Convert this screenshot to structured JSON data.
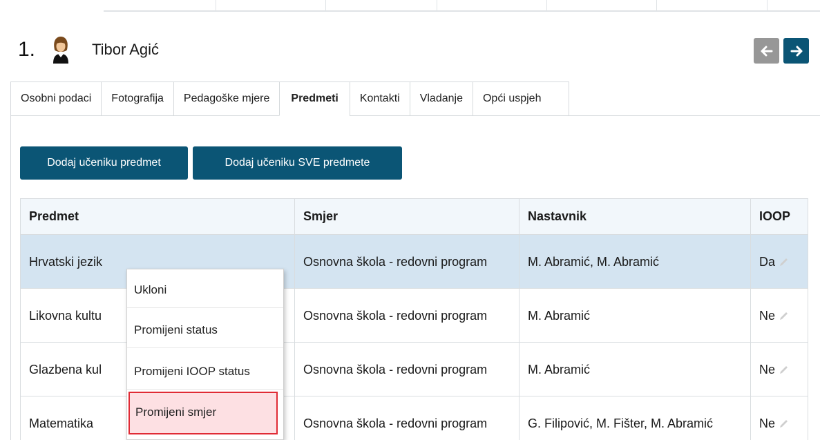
{
  "header": {
    "number": "1.",
    "student_name": "Tibor Agić"
  },
  "tabs": [
    {
      "label": "Osobni podaci",
      "active": false
    },
    {
      "label": "Fotografija",
      "active": false
    },
    {
      "label": "Pedagoške mjere",
      "active": false
    },
    {
      "label": "Predmeti",
      "active": true
    },
    {
      "label": "Kontakti",
      "active": false
    },
    {
      "label": "Vladanje",
      "active": false
    },
    {
      "label": "Opći uspjeh",
      "active": false
    }
  ],
  "actions": {
    "add_subject": "Dodaj učeniku predmet",
    "add_all_subjects": "Dodaj učeniku SVE predmete"
  },
  "table": {
    "headers": [
      "Predmet",
      "Smjer",
      "Nastavnik",
      "IOOP"
    ],
    "rows": [
      {
        "predmet": "Hrvatski jezik",
        "smjer": "Osnovna škola - redovni program",
        "nastavnik": "M. Abramić, M. Abramić",
        "ioop": "Da"
      },
      {
        "predmet": "Likovna kultu",
        "smjer": "Osnovna škola - redovni program",
        "nastavnik": "M. Abramić",
        "ioop": "Ne"
      },
      {
        "predmet": "Glazbena kul",
        "smjer": "Osnovna škola - redovni program",
        "nastavnik": "M. Abramić",
        "ioop": "Ne"
      },
      {
        "predmet": "Matematika",
        "smjer": "Osnovna škola - redovni program",
        "nastavnik": "G. Filipović, M. Fišter, M. Abramić",
        "ioop": "Ne"
      }
    ]
  },
  "context_menu": {
    "items": [
      "Ukloni",
      "Promijeni status",
      "Promijeni IOOP status",
      "Promijeni smjer"
    ],
    "highlighted": "Promijeni smjer"
  },
  "colors": {
    "primary": "#0b5575",
    "selected_row": "#d4e4f1",
    "highlight_border": "#e02b35",
    "highlight_fill": "#fde0e3"
  },
  "icons": {
    "avatar": "user-avatar-icon",
    "prev": "arrow-left-icon",
    "next": "arrow-right-icon",
    "edit": "pencil-icon"
  }
}
